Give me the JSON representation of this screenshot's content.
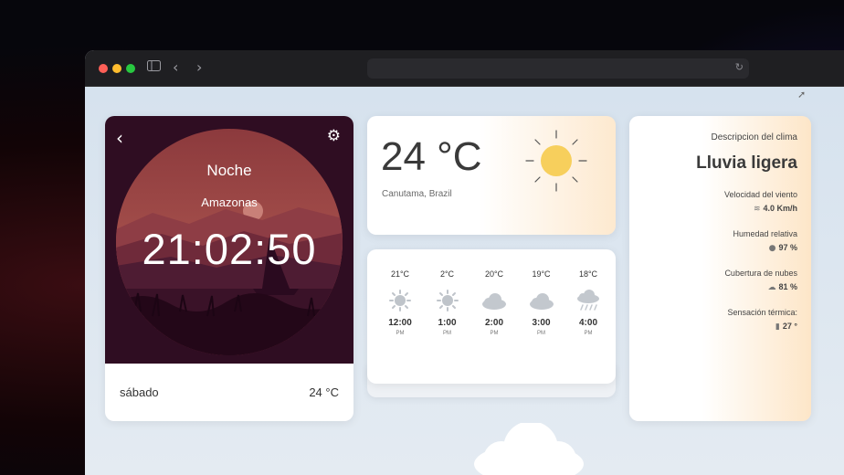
{
  "clock": {
    "period": "Noche",
    "place": "Amazonas",
    "time": "21:02:50",
    "day": "sábado",
    "temp": "24 °C"
  },
  "current": {
    "temp": "24 °C",
    "location": "Canutama, Brazil"
  },
  "forecast": [
    {
      "temp": "21°C",
      "icon": "sun-icon",
      "hour": "12:00",
      "ampm": "PM"
    },
    {
      "temp": "2°C",
      "icon": "sun-icon",
      "hour": "1:00",
      "ampm": "PM"
    },
    {
      "temp": "20°C",
      "icon": "cloud-icon",
      "hour": "2:00",
      "ampm": "PM"
    },
    {
      "temp": "19°C",
      "icon": "cloud-icon",
      "hour": "3:00",
      "ampm": "PM"
    },
    {
      "temp": "18°C",
      "icon": "rain-cloud-icon",
      "hour": "4:00",
      "ampm": "PM"
    }
  ],
  "details": {
    "title": "Descripcion del clima",
    "description": "Lluvia ligera",
    "wind_label": "Velocidad del viento",
    "wind_value": "4.0 Km/h",
    "humidity_label": "Humedad relativa",
    "humidity_value": "97 %",
    "clouds_label": "Cubertura de nubes",
    "clouds_value": "81 %",
    "feels_label": "Sensación térmica:",
    "feels_value": "27 °"
  },
  "colors": {
    "clock_bg": "#2f0d22",
    "sun": "#f7cf5c",
    "accent_gradient_end": "#fde9cf"
  }
}
